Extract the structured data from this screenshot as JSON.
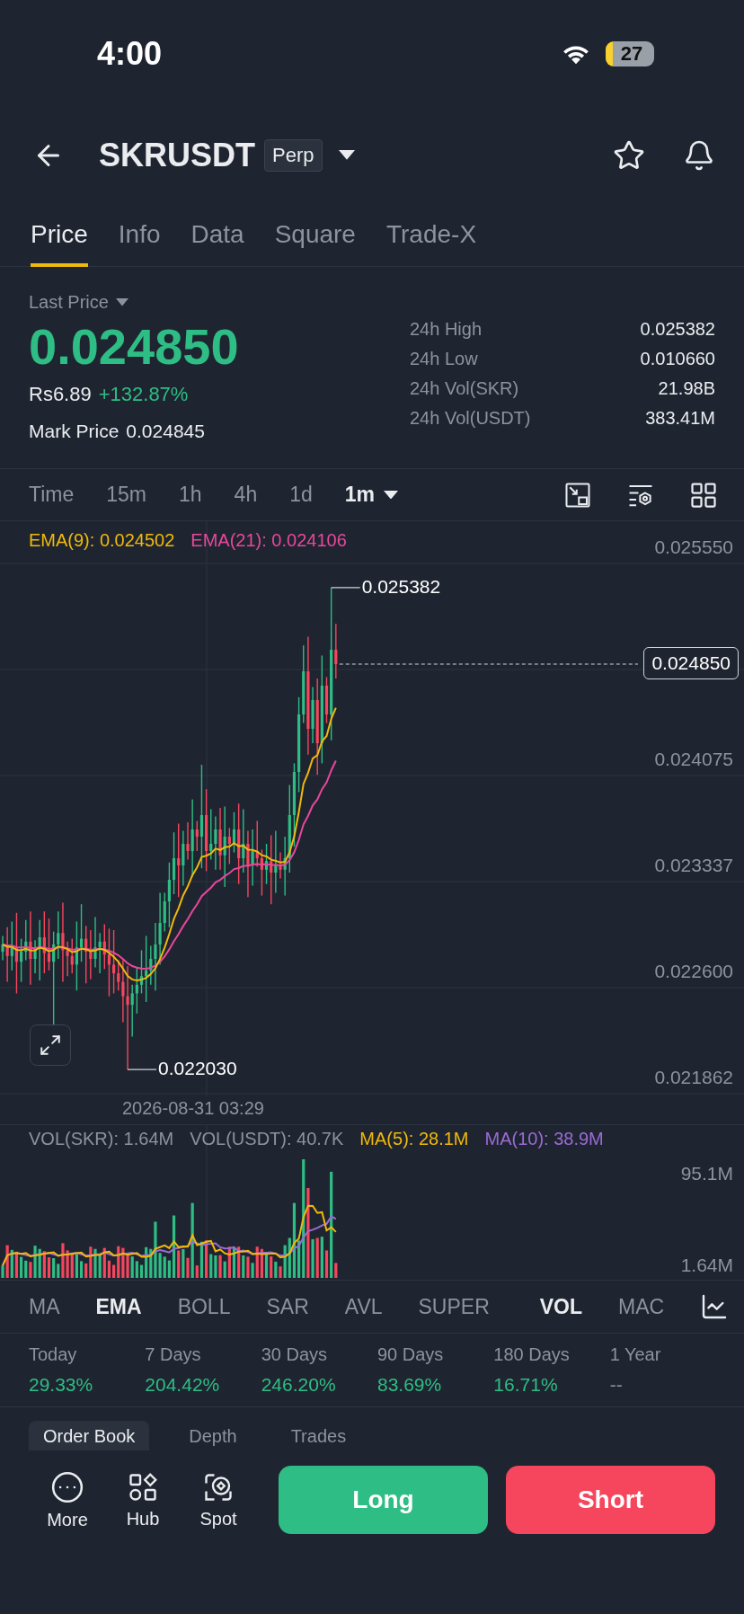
{
  "status_bar": {
    "time": "4:00",
    "battery": "27"
  },
  "header": {
    "symbol": "SKRUSDT",
    "badge": "Perp"
  },
  "tabs": [
    {
      "label": "Price",
      "selected": true
    },
    {
      "label": "Info",
      "selected": false
    },
    {
      "label": "Data",
      "selected": false
    },
    {
      "label": "Square",
      "selected": false
    },
    {
      "label": "Trade-X",
      "selected": false
    }
  ],
  "price": {
    "label": "Last Price",
    "last": "0.024850",
    "local": "Rs6.89",
    "change": "+132.87%",
    "mark_label": "Mark Price",
    "mark": "0.024845",
    "stats": [
      {
        "label": "24h High",
        "value": "0.025382"
      },
      {
        "label": "24h Low",
        "value": "0.010660"
      },
      {
        "label": "24h Vol(SKR)",
        "value": "21.98B"
      },
      {
        "label": "24h Vol(USDT)",
        "value": "383.41M"
      }
    ]
  },
  "timeframes": [
    {
      "label": "Time",
      "selected": false
    },
    {
      "label": "15m",
      "selected": false
    },
    {
      "label": "1h",
      "selected": false
    },
    {
      "label": "4h",
      "selected": false
    },
    {
      "label": "1d",
      "selected": false
    },
    {
      "label": "1m",
      "selected": true
    }
  ],
  "chart": {
    "legend": [
      {
        "text": "EMA(9): 0.024502",
        "color": "#f0b90b"
      },
      {
        "text": "EMA(21): 0.024106",
        "color": "#e8479c"
      }
    ],
    "y_axis": [
      "0.025550",
      "0.024075",
      "0.023337",
      "0.022600",
      "0.021862"
    ],
    "high_marker": "0.025382",
    "low_marker": "0.022030",
    "price_tag": "0.024850",
    "time_label": "2026-08-31 03:29"
  },
  "volume": {
    "legend": [
      {
        "text": "VOL(SKR): 1.64M",
        "color": "#8d939e"
      },
      {
        "text": "VOL(USDT): 40.7K",
        "color": "#8d939e"
      },
      {
        "text": "MA(5): 28.1M",
        "color": "#f0b90b"
      },
      {
        "text": "MA(10): 38.9M",
        "color": "#9b6bd6"
      }
    ],
    "y_axis": [
      "95.1M",
      "1.64M"
    ]
  },
  "indicators": {
    "main": [
      {
        "label": "MA",
        "selected": false
      },
      {
        "label": "EMA",
        "selected": true
      },
      {
        "label": "BOLL",
        "selected": false
      },
      {
        "label": "SAR",
        "selected": false
      },
      {
        "label": "AVL",
        "selected": false
      },
      {
        "label": "SUPER",
        "selected": false
      }
    ],
    "sub": [
      {
        "label": "VOL",
        "selected": true
      },
      {
        "label": "MAC",
        "selected": false
      }
    ]
  },
  "performance": [
    {
      "label": "Today",
      "value": "29.33%",
      "positive": true
    },
    {
      "label": "7 Days",
      "value": "204.42%",
      "positive": true
    },
    {
      "label": "30 Days",
      "value": "246.20%",
      "positive": true
    },
    {
      "label": "90 Days",
      "value": "83.69%",
      "positive": true
    },
    {
      "label": "180 Days",
      "value": "16.71%",
      "positive": true
    },
    {
      "label": "1 Year",
      "value": "--",
      "positive": false
    }
  ],
  "book_tabs": [
    {
      "label": "Order Book",
      "selected": true
    },
    {
      "label": "Depth",
      "selected": false
    },
    {
      "label": "Trades",
      "selected": false
    }
  ],
  "bottom_bar": {
    "actions": [
      {
        "label": "More",
        "kind": "more"
      },
      {
        "label": "Hub",
        "kind": "hub"
      },
      {
        "label": "Spot",
        "kind": "spot"
      }
    ],
    "long": "Long",
    "short": "Short"
  }
}
